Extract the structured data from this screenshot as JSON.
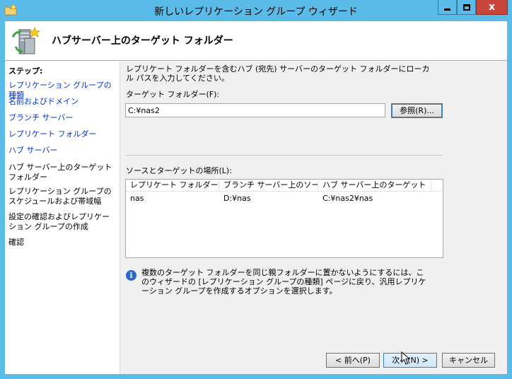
{
  "window": {
    "title": "新しいレプリケーション グループ ウィザード",
    "minimize_icon": "minimize-icon",
    "maximize_icon": "maximize-icon",
    "close_icon": "close-icon",
    "close_glyph": "x"
  },
  "header": {
    "title": "ハブサーバー上のターゲット フォルダー",
    "icon": "replication-server-icon"
  },
  "steps": {
    "heading": "ステップ:",
    "items": [
      {
        "label": "レプリケーション グループの種類",
        "state": "link"
      },
      {
        "label": "名前およびドメイン",
        "state": "link"
      },
      {
        "label": "ブランチ サーバー",
        "state": "link"
      },
      {
        "label": "レプリケート フォルダー",
        "state": "link"
      },
      {
        "label": "ハブ サーバー",
        "state": "link"
      },
      {
        "label": "ハブ サーバー上のターゲット フォルダー",
        "state": "current"
      },
      {
        "label": "レプリケーション グループのスケジュールおよび帯域幅",
        "state": "disabled"
      },
      {
        "label": "設定の確認およびレプリケーション グループの作成",
        "state": "disabled"
      },
      {
        "label": "確認",
        "state": "disabled"
      }
    ]
  },
  "main": {
    "description": "レプリケート フォルダーを含むハブ (宛先) サーバーのターゲット フォルダーにローカル パスを入力してください。",
    "target_label": "ターゲット フォルダー(F):",
    "target_value": "C:¥nas2",
    "browse_label": "参照(R)...",
    "locations_label": "ソースとターゲットの場所(L):",
    "columns": [
      "レプリケート フォルダーの...",
      "ブランチ サーバー上のソー...",
      "ハブ サーバー上のターゲット"
    ],
    "rows": [
      [
        "nas",
        "D:¥nas",
        "C:¥nas2¥nas"
      ]
    ],
    "info_icon": "info-icon",
    "info_text": "複数のターゲット フォルダーを同じ親フォルダーに置かないようにするには、このウィザードの [レプリケーション グループの種類] ページに戻り、汎用レプリケーション グループを作成するオプションを選択します。"
  },
  "footer": {
    "back_label": "< 前へ(P)",
    "next_label": "次へ(N) >",
    "cancel_label": "キャンセル"
  }
}
